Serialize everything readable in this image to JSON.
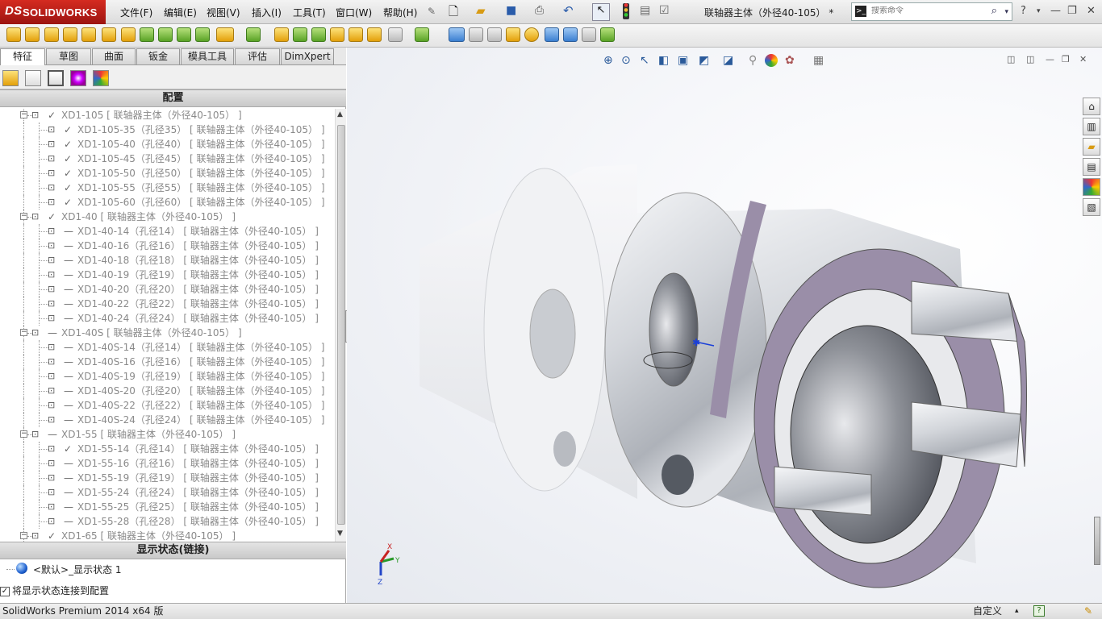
{
  "app": {
    "brand": "SOLIDWORKS",
    "brand_prefix": "DS",
    "window_title": "联轴器主体（外径40-105）  *"
  },
  "menu": [
    "文件(F)",
    "编辑(E)",
    "视图(V)",
    "插入(I)",
    "工具(T)",
    "窗口(W)",
    "帮助(H)"
  ],
  "search": {
    "placeholder": "搜索命令",
    "icon": "search-icon"
  },
  "left_tabs": [
    "特征",
    "草图",
    "曲面",
    "钣金",
    "模具工具",
    "评估",
    "DimXpert"
  ],
  "config_section": {
    "title": "配置"
  },
  "tree": [
    {
      "level": 0,
      "state": "check",
      "text": "XD1-105 [ 联轴器主体（外径40-105） ]"
    },
    {
      "level": 1,
      "state": "check",
      "text": "XD1-105-35（孔径35） [ 联轴器主体（外径40-105） ]"
    },
    {
      "level": 1,
      "state": "check",
      "text": "XD1-105-40（孔径40） [ 联轴器主体（外径40-105） ]"
    },
    {
      "level": 1,
      "state": "check",
      "text": "XD1-105-45（孔径45） [ 联轴器主体（外径40-105） ]"
    },
    {
      "level": 1,
      "state": "check",
      "text": "XD1-105-50（孔径50） [ 联轴器主体（外径40-105） ]"
    },
    {
      "level": 1,
      "state": "check",
      "text": "XD1-105-55（孔径55） [ 联轴器主体（外径40-105） ]"
    },
    {
      "level": 1,
      "state": "check",
      "text": "XD1-105-60（孔径60） [ 联轴器主体（外径40-105） ]"
    },
    {
      "level": 0,
      "state": "check",
      "text": "XD1-40 [ 联轴器主体（外径40-105） ]"
    },
    {
      "level": 1,
      "state": "dash",
      "text": "XD1-40-14（孔径14） [ 联轴器主体（外径40-105） ]"
    },
    {
      "level": 1,
      "state": "dash",
      "text": "XD1-40-16（孔径16） [ 联轴器主体（外径40-105） ]"
    },
    {
      "level": 1,
      "state": "dash",
      "text": "XD1-40-18（孔径18） [ 联轴器主体（外径40-105） ]"
    },
    {
      "level": 1,
      "state": "dash",
      "text": "XD1-40-19（孔径19） [ 联轴器主体（外径40-105） ]"
    },
    {
      "level": 1,
      "state": "dash",
      "text": "XD1-40-20（孔径20） [ 联轴器主体（外径40-105） ]"
    },
    {
      "level": 1,
      "state": "dash",
      "text": "XD1-40-22（孔径22） [ 联轴器主体（外径40-105） ]"
    },
    {
      "level": 1,
      "state": "dash",
      "text": "XD1-40-24（孔径24） [ 联轴器主体（外径40-105） ]"
    },
    {
      "level": 0,
      "state": "dash",
      "text": "XD1-40S [ 联轴器主体（外径40-105） ]"
    },
    {
      "level": 1,
      "state": "dash",
      "text": "XD1-40S-14（孔径14） [ 联轴器主体（外径40-105） ]"
    },
    {
      "level": 1,
      "state": "dash",
      "text": "XD1-40S-16（孔径16） [ 联轴器主体（外径40-105） ]"
    },
    {
      "level": 1,
      "state": "dash",
      "text": "XD1-40S-19（孔径19） [ 联轴器主体（外径40-105） ]"
    },
    {
      "level": 1,
      "state": "dash",
      "text": "XD1-40S-20（孔径20） [ 联轴器主体（外径40-105） ]"
    },
    {
      "level": 1,
      "state": "dash",
      "text": "XD1-40S-22（孔径22） [ 联轴器主体（外径40-105） ]"
    },
    {
      "level": 1,
      "state": "dash",
      "text": "XD1-40S-24（孔径24） [ 联轴器主体（外径40-105） ]"
    },
    {
      "level": 0,
      "state": "dash",
      "text": "XD1-55 [ 联轴器主体（外径40-105） ]"
    },
    {
      "level": 1,
      "state": "check",
      "text": "XD1-55-14（孔径14） [ 联轴器主体（外径40-105） ]"
    },
    {
      "level": 1,
      "state": "dash",
      "text": "XD1-55-16（孔径16） [ 联轴器主体（外径40-105） ]"
    },
    {
      "level": 1,
      "state": "dash",
      "text": "XD1-55-19（孔径19） [ 联轴器主体（外径40-105） ]"
    },
    {
      "level": 1,
      "state": "dash",
      "text": "XD1-55-24（孔径24） [ 联轴器主体（外径40-105） ]"
    },
    {
      "level": 1,
      "state": "dash",
      "text": "XD1-55-25（孔径25） [ 联轴器主体（外径40-105） ]"
    },
    {
      "level": 1,
      "state": "dash",
      "text": "XD1-55-28（孔径28） [ 联轴器主体（外径40-105） ]"
    },
    {
      "level": 0,
      "state": "check",
      "text": "XD1-65 [ 联轴器主体（外径40-105） ]"
    }
  ],
  "display_section": {
    "title": "显示状态(链接)",
    "item": "<默认>_显示状态 1"
  },
  "link_checkbox": {
    "label": "将显示状态连接到配置",
    "checked": true
  },
  "statusbar": {
    "left": "SolidWorks Premium 2014 x64 版",
    "right": "自定义"
  },
  "colors": {
    "brand_red": "#c41f16",
    "purple_face": "#9a8ea8",
    "steel": "#d7d9dd"
  }
}
